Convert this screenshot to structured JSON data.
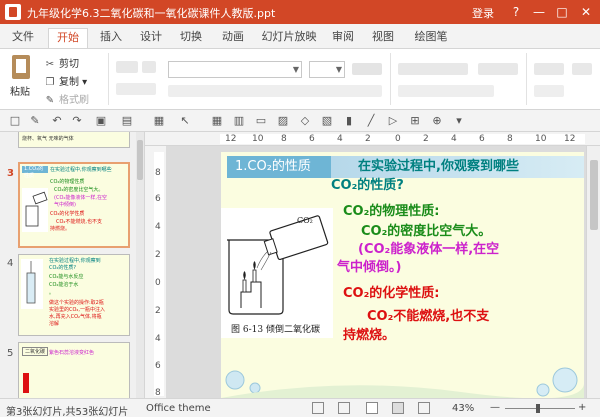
{
  "window": {
    "title": "九年级化学6.3二氧化碳和一氧化碳课件人教版.ppt",
    "login": "登录",
    "controls": [
      "?",
      "—",
      "□",
      "✕"
    ]
  },
  "tabs": [
    "文件",
    "开始",
    "插入",
    "设计",
    "切换",
    "动画",
    "幻灯片放映",
    "审阅",
    "视图",
    "绘图笔"
  ],
  "active_tab": "开始",
  "ribbon": {
    "paste": "粘贴",
    "cut": "剪切",
    "copy": "复制",
    "format_painter": "格式刷"
  },
  "thumbnails": {
    "numbers": [
      "3",
      "4",
      "5"
    ],
    "current": "3",
    "top_partial_text": "烧杯、氧气    无味的气体",
    "slide3_lines": [
      "1.CO₂的性质",
      "在实验过程中,你观察到哪些",
      "CO₂的物理性质",
      "CO₂的密度比空气大。",
      "(CO₂能像液体一样,在空",
      "气中倾倒)",
      "CO₂的化学性质",
      "CO₂不能燃烧,也不支",
      "持燃烧。"
    ],
    "slide4_lines": [
      "在实验过程中,你观察到",
      "CO₂的性质?",
      "CO₂能与水反应",
      "CO₂能溶于水",
      "。",
      "做这个实验的操作:取2瓶",
      "实验里的CO₂,一瓶中注入",
      "水,再充入CO₂气体,将瓶",
      "溶解"
    ],
    "slide5_lines": [
      "二氧化碳",
      "紫色石蕊溶液变红色"
    ]
  },
  "ruler": {
    "h_ticks": [
      "12",
      "10",
      "8",
      "6",
      "4",
      "2",
      "0",
      "2",
      "4",
      "6",
      "8",
      "10",
      "12"
    ],
    "v_ticks": [
      "8",
      "6",
      "4",
      "2",
      "0",
      "2",
      "4",
      "6",
      "8"
    ]
  },
  "slide": {
    "title_label": "1.CO₂的性质",
    "question_line1": "在实验过程中,你观察到哪些",
    "question_line2": "CO₂的性质?",
    "physical_heading": "CO₂的物理性质:",
    "density": "CO₂的密度比空气大。",
    "pour_line1": "(CO₂能象液体一样,在空",
    "pour_line2": "气中倾倒。)",
    "chemical_heading": "CO₂的化学性质:",
    "burn_line1": "CO₂不能燃烧,也不支",
    "burn_line2": "持燃烧。",
    "figure_caption": "图 6-13   倾倒二氧化碳",
    "bottle_label": "CO₂"
  },
  "status": {
    "slide_info": "第3张幻灯片,共53张幻灯片",
    "theme": "Office theme",
    "zoom": "43%",
    "zoom_minus": "—",
    "zoom_plus": "+"
  },
  "colors": {
    "accent": "#d24726",
    "slide_bg": "#fbfde0",
    "title_box": "#6eb5d5",
    "teal_text": "#008080",
    "green_text": "#1a8c1a",
    "magenta_text": "#cc22cc",
    "red_text": "#dd1111"
  }
}
